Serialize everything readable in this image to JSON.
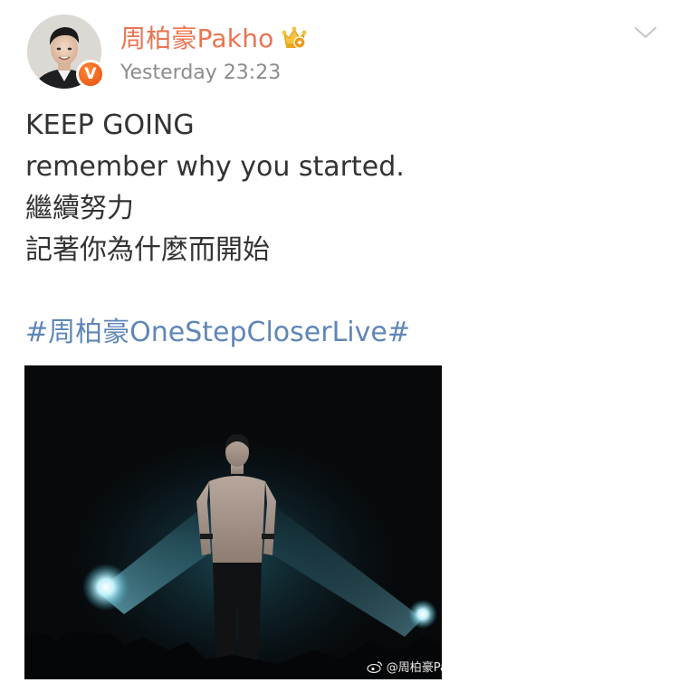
{
  "post": {
    "author": {
      "name": "周柏豪Pakho",
      "verified_badge": "V",
      "member_icon": "crown-icon",
      "name_color": "#eb7350",
      "badge_color": "#f0641e"
    },
    "timestamp": "Yesterday 23:23",
    "menu_icon": "chevron-down-icon",
    "text_lines": [
      "KEEP GOING",
      "remember why you started.",
      "繼續努力",
      "記著你為什麼而開始"
    ],
    "hashtag": "#周柏豪OneStepCloserLive#",
    "hashtag_color": "#5f86b8",
    "image": {
      "watermark": "@周柏豪Pa",
      "watermark_icon": "weibo-logo-icon"
    }
  }
}
